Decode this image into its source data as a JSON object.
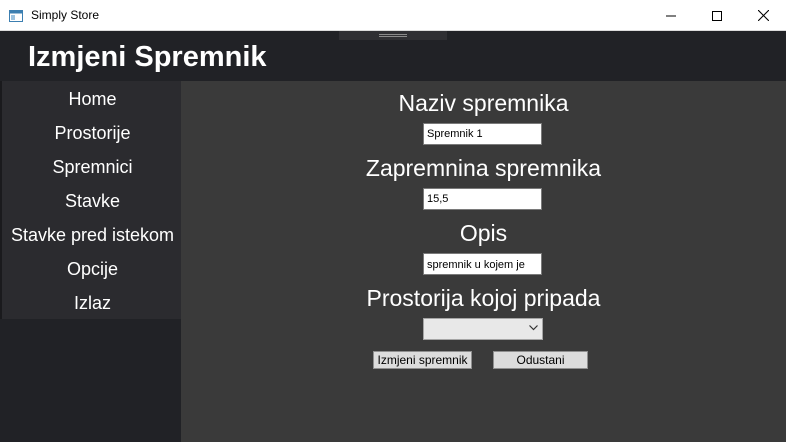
{
  "window": {
    "title": "Simply Store",
    "icons": {
      "app": "app-window-icon",
      "minimize": "minimize-icon",
      "maximize": "maximize-icon",
      "close": "close-icon"
    }
  },
  "header": {
    "title": "Izmjeni Spremnik"
  },
  "sidebar": {
    "items": [
      {
        "label": "Home"
      },
      {
        "label": "Prostorije"
      },
      {
        "label": "Spremnici"
      },
      {
        "label": "Stavke"
      },
      {
        "label": "Stavke pred istekom"
      },
      {
        "label": "Opcije"
      },
      {
        "label": "Izlaz"
      }
    ]
  },
  "form": {
    "name_label": "Naziv spremnika",
    "name_value": "Spremnik 1",
    "volume_label": "Zapremnina spremnika",
    "volume_value": "15,5",
    "description_label": "Opis",
    "description_value": "spremnik u kojem je",
    "room_label": "Prostorija kojoj pripada",
    "room_value": "",
    "save_label": "Izmjeni spremnik",
    "cancel_label": "Odustani"
  },
  "colors": {
    "header_bg": "#212226",
    "sidebar_menu_bg": "#2b2b2f",
    "content_bg": "#3a3a3a",
    "text": "#ffffff"
  }
}
